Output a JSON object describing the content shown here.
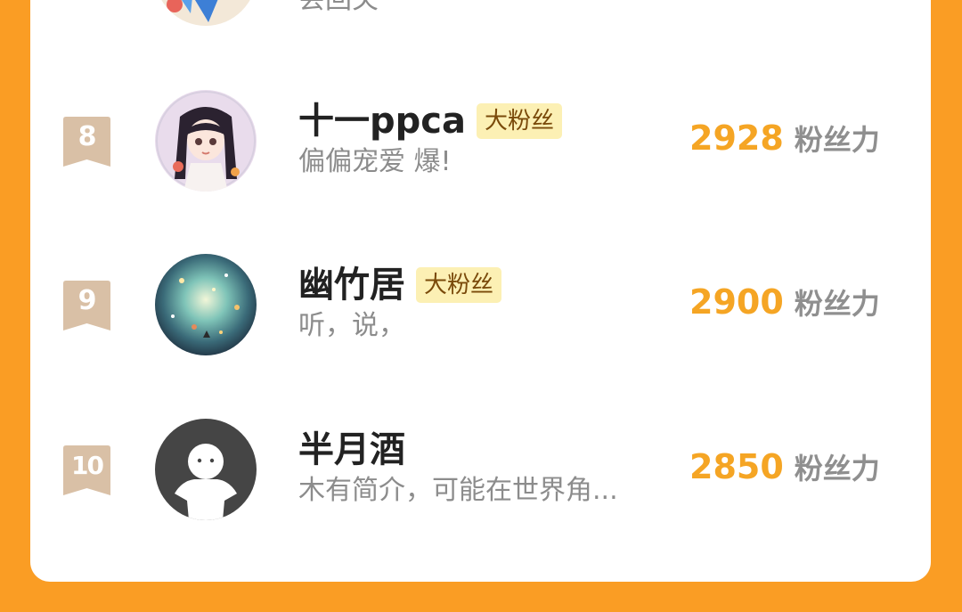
{
  "colors": {
    "page_background": "#fa9d24",
    "card": "#ffffff",
    "rank_ribbon": "#d9c0a6",
    "badge_background": "#fcf0b4",
    "score": "#f5a524",
    "name": "#222222",
    "bio": "#8c8c8c"
  },
  "partial_row": {
    "bio": "会回关",
    "avatar_icon": "anime-avatar-blue-icon"
  },
  "leaderboard": [
    {
      "rank": "8",
      "name": "十一ppca",
      "badge": "大粉丝",
      "bio": "偏偏宠爱 爆!",
      "score": "2928",
      "score_unit": "粉丝力",
      "avatar_icon": "anime-girl-avatar-icon"
    },
    {
      "rank": "9",
      "name": "幽竹居",
      "badge": "大粉丝",
      "bio": "听，说，",
      "score": "2900",
      "score_unit": "粉丝力",
      "avatar_icon": "starry-galaxy-avatar-icon"
    },
    {
      "rank": "10",
      "name": "半月酒",
      "badge": "",
      "bio": "木有简介，可能在世界角...",
      "score": "2850",
      "score_unit": "粉丝力",
      "avatar_icon": "default-user-avatar-icon"
    }
  ]
}
